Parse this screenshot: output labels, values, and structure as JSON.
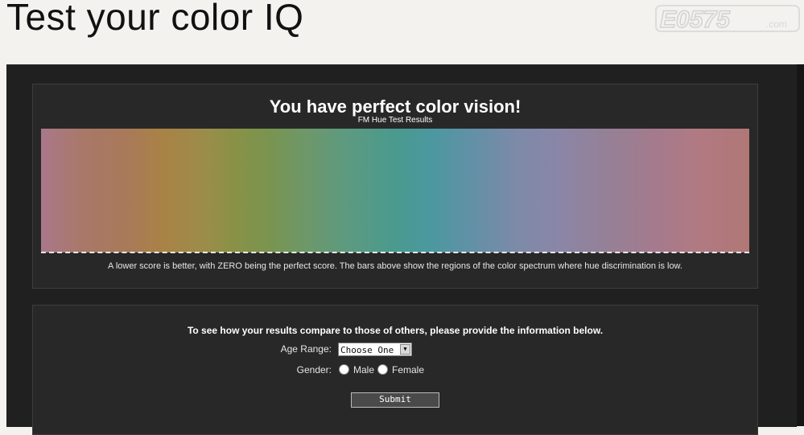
{
  "page": {
    "title": "Test your color IQ"
  },
  "watermark": {
    "text": "E0575",
    "suffix": ".com"
  },
  "results": {
    "headline": "You have perfect color vision!",
    "subheadline": "FM Hue Test Results",
    "explanation": "A lower score is better, with ZERO being the perfect score. The bars above show the regions of the color spectrum where hue discrimination is low."
  },
  "form": {
    "intro": "To see how your results compare to those of others, please provide the information below.",
    "age_label": "Age Range:",
    "age_selected": "Choose One",
    "gender_label": "Gender:",
    "gender_options": [
      "Male",
      "Female"
    ],
    "submit_label": "Submit"
  }
}
